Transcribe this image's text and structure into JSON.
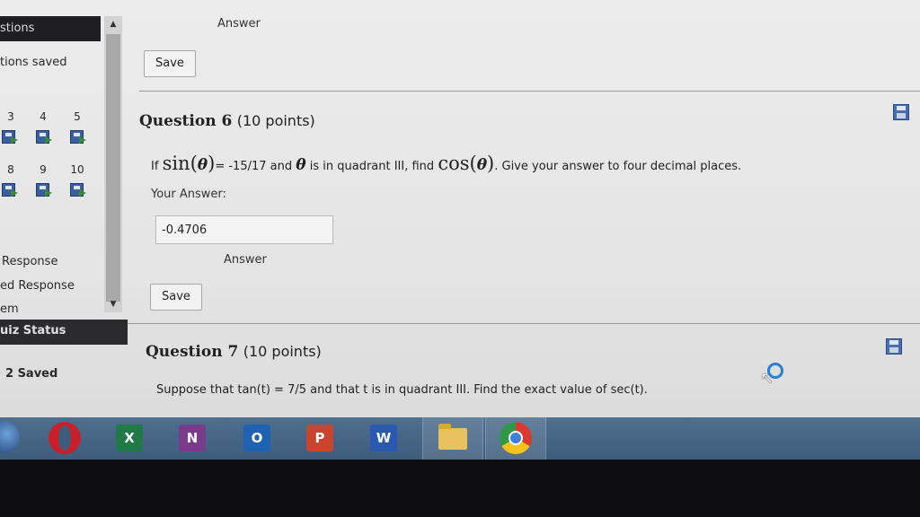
{
  "sidebar": {
    "header": "stions",
    "saved_label": "tions saved",
    "question_numbers_row1": [
      "3",
      "4",
      "5"
    ],
    "question_numbers_row2": [
      "8",
      "9",
      "10"
    ],
    "response": "Response",
    "saved_response": "ed Response",
    "item": "em",
    "quiz_status": "uiz Status",
    "saved_count": "2 Saved"
  },
  "top": {
    "answer_label": "Answer",
    "save_label": "Save"
  },
  "question6": {
    "number": "Question 6",
    "points": "(10 points)",
    "text_if": "If",
    "sin": "sin(",
    "theta": "θ",
    "close_paren": ")",
    "value": "= -15/17 and",
    "quadrant": "is in quadrant III, find",
    "cos": "cos(",
    "tail": ".  Give your answer to four decimal places.",
    "your_answer_label": "Your Answer:",
    "answer_value": "-0.4706",
    "answer_label": "Answer",
    "save_label": "Save"
  },
  "question7": {
    "number": "Question 7",
    "points": "(10 points)",
    "text": "Suppose that tan(t) = 7/5 and that t is in quadrant III. Find the exact value of sec(t)."
  },
  "taskbar": {
    "apps": [
      {
        "name": "excel",
        "glyph": "X",
        "color": "#1f7a44"
      },
      {
        "name": "onenote",
        "glyph": "N",
        "color": "#7a3b8c"
      },
      {
        "name": "outlook",
        "glyph": "O",
        "color": "#1e62b4"
      },
      {
        "name": "powerpoint",
        "glyph": "P",
        "color": "#c8442a"
      },
      {
        "name": "word",
        "glyph": "W",
        "color": "#2a5ab0"
      }
    ]
  }
}
